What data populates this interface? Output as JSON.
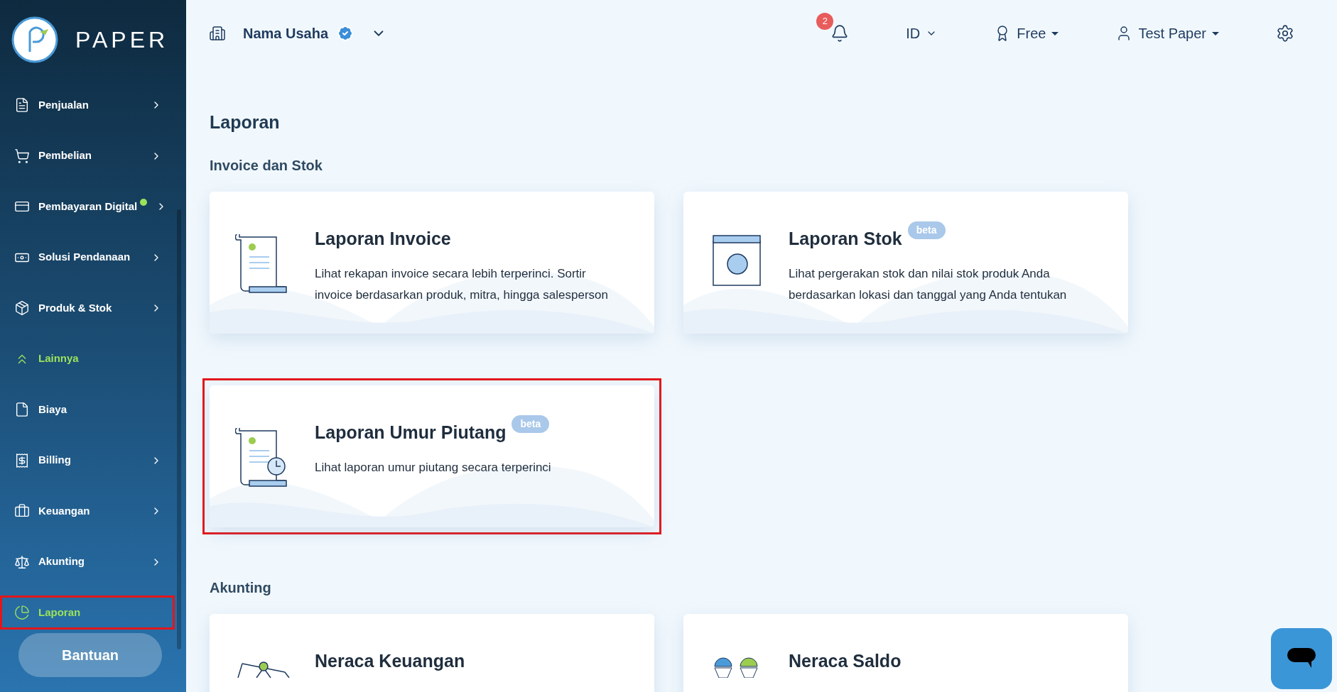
{
  "logo": {
    "name": "PAPER"
  },
  "sidebar": {
    "items": [
      {
        "label": "Penjualan",
        "kind": "invoice",
        "chevron": true,
        "active": false,
        "dot": false,
        "highlighted": false
      },
      {
        "label": "Pembelian",
        "kind": "cart",
        "chevron": true,
        "active": false,
        "dot": false,
        "highlighted": false
      },
      {
        "label": "Pembayaran Digital",
        "kind": "card",
        "chevron": true,
        "active": false,
        "dot": true,
        "highlighted": false
      },
      {
        "label": "Solusi Pendanaan",
        "kind": "money",
        "chevron": true,
        "active": false,
        "dot": false,
        "highlighted": false
      },
      {
        "label": "Produk & Stok",
        "kind": "box",
        "chevron": true,
        "active": false,
        "dot": false,
        "highlighted": false
      },
      {
        "label": "Lainnya",
        "kind": "more",
        "chevron": false,
        "active": true,
        "dot": false,
        "highlighted": false
      },
      {
        "label": "Biaya",
        "kind": "file",
        "chevron": false,
        "active": false,
        "dot": false,
        "highlighted": false
      },
      {
        "label": "Billing",
        "kind": "bill",
        "chevron": true,
        "active": false,
        "dot": false,
        "highlighted": false
      },
      {
        "label": "Keuangan",
        "kind": "bag",
        "chevron": true,
        "active": false,
        "dot": false,
        "highlighted": false
      },
      {
        "label": "Akunting",
        "kind": "scale",
        "chevron": true,
        "active": false,
        "dot": false,
        "highlighted": false
      },
      {
        "label": "Laporan",
        "kind": "pie",
        "chevron": false,
        "active": true,
        "dot": false,
        "highlighted": true
      }
    ],
    "help_button": "Bantuan"
  },
  "header": {
    "business": "Nama Usaha",
    "notifications": "2",
    "language": "ID",
    "plan": "Free",
    "user": "Test Paper"
  },
  "page": {
    "title": "Laporan",
    "sections": [
      {
        "title": "Invoice dan Stok",
        "cards": [
          {
            "kind": "invoice",
            "title": "Laporan Invoice",
            "description": "Lihat rekapan invoice secara lebih terperinci. Sortir invoice berdasarkan produk, mitra, hingga salesperson",
            "highlighted": false
          },
          {
            "kind": "stock",
            "title": "Laporan Stok",
            "badge": "beta",
            "description": "Lihat pergerakan stok dan nilai stok produk Anda berdasarkan lokasi dan tanggal yang Anda tentukan",
            "highlighted": false
          },
          {
            "kind": "aging",
            "title": "Laporan Umur Piutang",
            "badge": "beta",
            "description": "Lihat laporan umur piutang secara terperinci",
            "highlighted": true
          }
        ]
      },
      {
        "title": "Akunting",
        "cards": [
          {
            "kind": "balance",
            "title": "Neraca Keuangan",
            "highlighted": false
          },
          {
            "kind": "trial",
            "title": "Neraca Saldo",
            "highlighted": false
          }
        ]
      }
    ]
  }
}
